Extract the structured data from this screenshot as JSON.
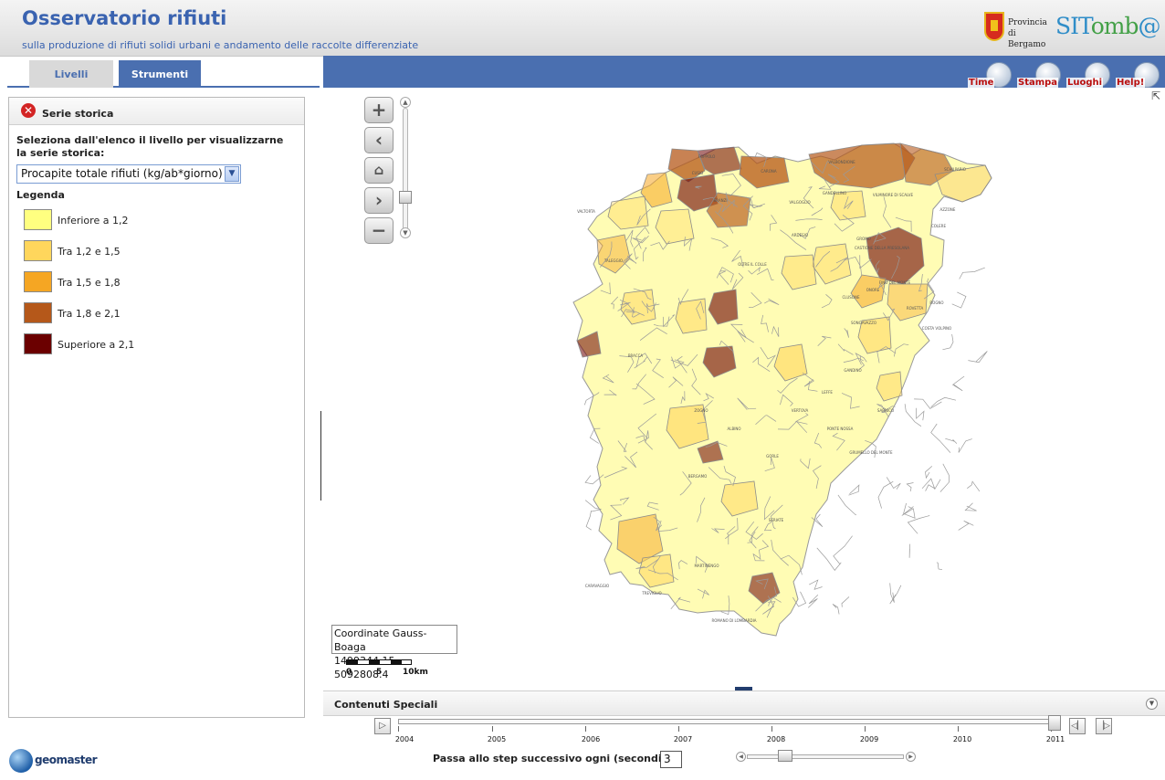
{
  "header": {
    "title": "Osservatorio rifiuti",
    "subtitle": "sulla produzione di rifiuti solidi urbani e andamento delle raccolte differenziate",
    "logo_provincia_line1": "Provincia",
    "logo_provincia_line2": "di Bergamo",
    "logo_sitomba_prefix": "SIT",
    "logo_sitomba_mid": "omb",
    "logo_sitomba_suffix": "@"
  },
  "tabs": [
    {
      "label": "Livelli",
      "active": false
    },
    {
      "label": "Strumenti",
      "active": true
    }
  ],
  "panel": {
    "title": "Serie storica",
    "instruction": "Seleziona dall'elenco il livello per visualizzarne la serie storica:",
    "select_value": "Procapite totale rifiuti (kg/ab*giorno)",
    "legend_title": "Legenda",
    "legend": [
      {
        "label": "Inferiore a 1,2",
        "color": "#ffff80"
      },
      {
        "label": "Tra 1,2 e 1,5",
        "color": "#ffd65c"
      },
      {
        "label": "Tra 1,5 e 1,8",
        "color": "#f5a623"
      },
      {
        "label": "Tra 1,8 e 2,1",
        "color": "#b5581a"
      },
      {
        "label": "Superiore a 2,1",
        "color": "#6b0000"
      }
    ]
  },
  "footer_logo": "geomaster",
  "toolbar": {
    "time": "Time",
    "stampa": "Stampa",
    "luoghi": "Luoghi",
    "help": "Help!"
  },
  "map": {
    "nav_icons": [
      "zoom-in-icon",
      "pan-back-icon",
      "home-icon",
      "pan-forward-icon",
      "zoom-out-icon"
    ],
    "coord_label": "Coordinate Gauss-Boaga",
    "coord_value": "1499344.15, 5092808.4",
    "scale_labels": [
      "0",
      "5",
      "10km"
    ],
    "place_labels": [
      "FOPPOLO",
      "CARONA",
      "VALBONDIONE",
      "SCHILPARIO",
      "VALTORTA",
      "CUSIO",
      "BRANZI",
      "VALGOGLIO",
      "GANDELLINO",
      "VILMINORE DI SCALVE",
      "AZZONE",
      "COLERE",
      "CASTIONE DELLA PRESOLANA",
      "ONORE",
      "ROVETTA",
      "SONGAVAZZO",
      "FINO DEL MONTE",
      "ROGNO",
      "COSTA VOLPINO",
      "TALEGGIO",
      "BRACCA",
      "ZOGNO",
      "ALBINO",
      "BERGAMO",
      "SERIATE",
      "GORLE",
      "TREVIGLIO",
      "ROMANO DI LOMBARDIA",
      "CLUSONE",
      "OLTRE IL COLLE",
      "ARDESIO",
      "GROMO",
      "PONTE NOSSA",
      "VERTOVA",
      "LEFFE",
      "GANDINO",
      "SARNICO",
      "GRUMELLO DEL MONTE",
      "CARAVAGGIO",
      "MARTINENGO"
    ]
  },
  "contenuti": {
    "title": "Contenuti Speciali"
  },
  "timeline": {
    "years": [
      "2004",
      "2005",
      "2006",
      "2007",
      "2008",
      "2009",
      "2010",
      "2011"
    ],
    "current_year": "2011",
    "step_label": "Passa allo step successivo ogni (secondi):",
    "step_value": "3",
    "speed_level": 0.2
  }
}
